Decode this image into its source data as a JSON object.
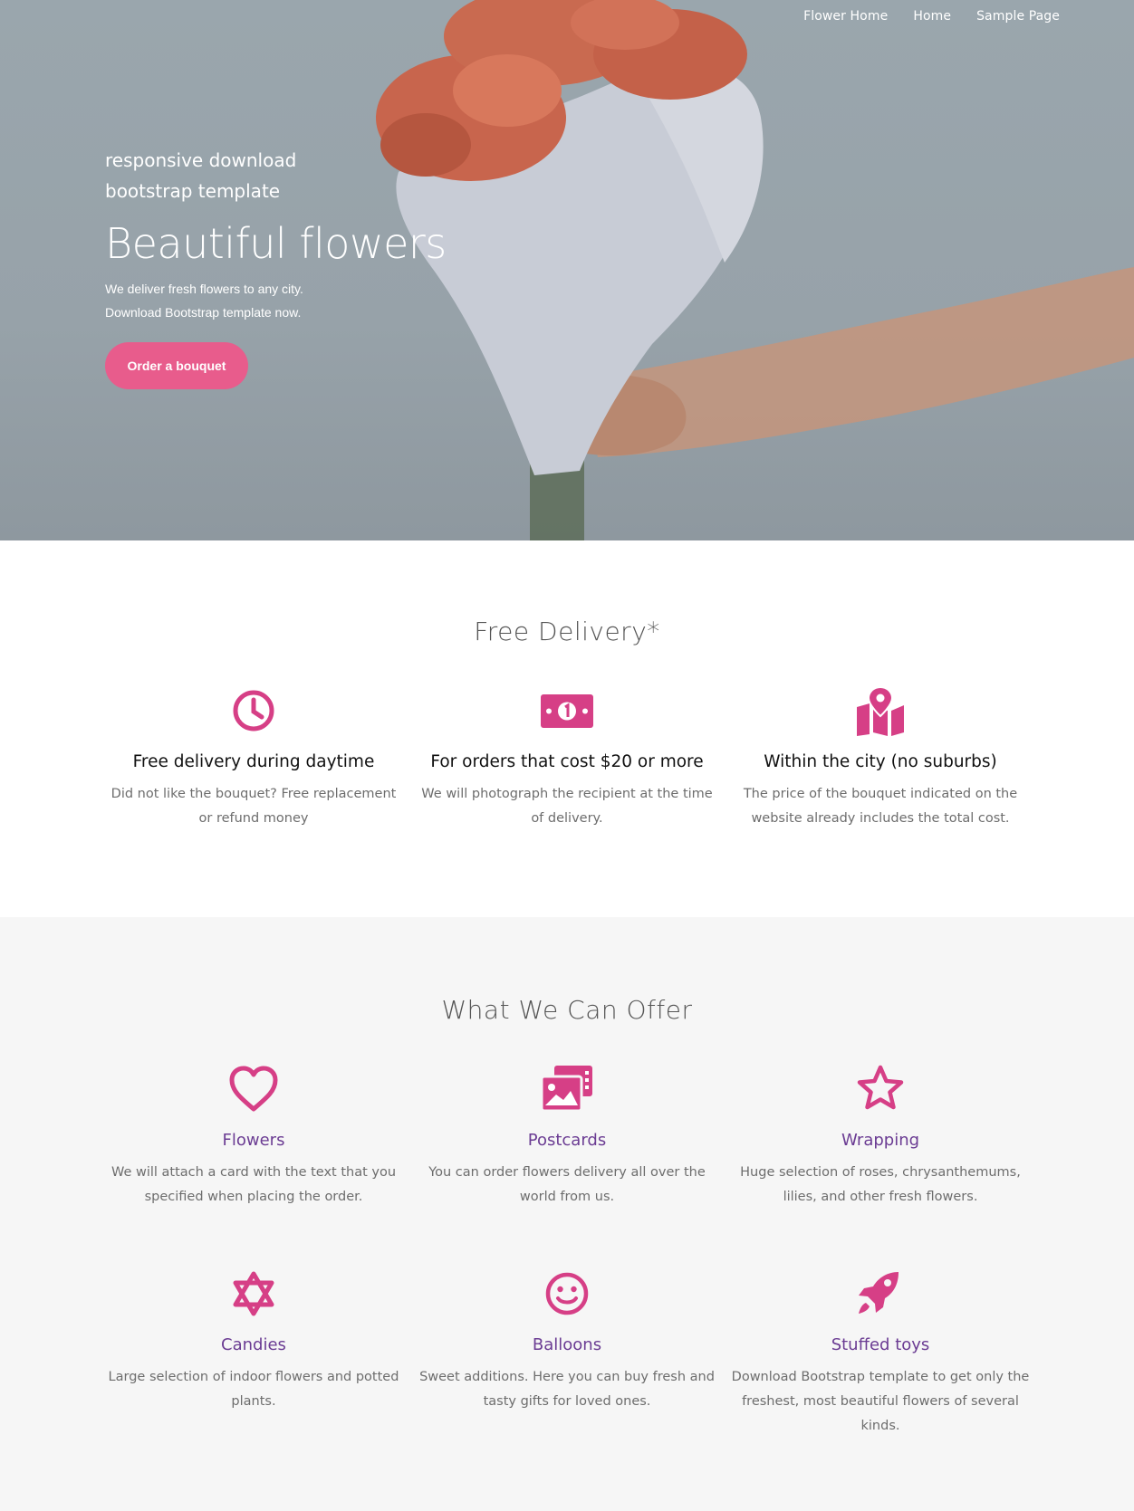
{
  "nav": {
    "items": [
      "Flower Home",
      "Home",
      "Sample Page"
    ]
  },
  "hero": {
    "kicker": "responsive download bootstrap template",
    "title": "Beautiful flowers",
    "line1": "We deliver fresh flowers to any city.",
    "line2": "Download Bootstrap template now.",
    "button": "Order a bouquet"
  },
  "delivery": {
    "title": "Free Delivery*",
    "features": [
      {
        "icon": "clock-icon",
        "heading": "Free delivery during daytime",
        "text": "Did not like the bouquet? Free replacement or refund money"
      },
      {
        "icon": "money-bill-icon",
        "heading": "For orders that cost $20 or more",
        "text": "We will photograph the recipient at the time of delivery."
      },
      {
        "icon": "map-marker-icon",
        "heading": "Within the city (no suburbs)",
        "text": "The price of the bouquet indicated on the website already includes the total cost."
      }
    ]
  },
  "offer": {
    "title": "What We Can Offer",
    "features": [
      {
        "icon": "heart-icon",
        "heading": "Flowers",
        "text": "We will attach a card with the text that you specified when placing the order."
      },
      {
        "icon": "images-icon",
        "heading": "Postcards",
        "text": "You can order flowers delivery all over the world from us."
      },
      {
        "icon": "star-icon",
        "heading": "Wrapping",
        "text": "Huge selection of roses, chrysanthemums, lilies, and other fresh flowers."
      },
      {
        "icon": "star-of-david-icon",
        "heading": "Candies",
        "text": "Large selection of indoor flowers and potted plants."
      },
      {
        "icon": "smile-icon",
        "heading": "Balloons",
        "text": "Sweet additions. Here you can buy fresh and tasty gifts for loved ones."
      },
      {
        "icon": "rocket-icon",
        "heading": "Stuffed toys",
        "text": "Download Bootstrap template to get only the freshest, most beautiful flowers of several kinds."
      }
    ]
  },
  "colors": {
    "accent": "#e85c8c",
    "icon": "#d63f86",
    "heading_purple": "#6b3c93"
  }
}
